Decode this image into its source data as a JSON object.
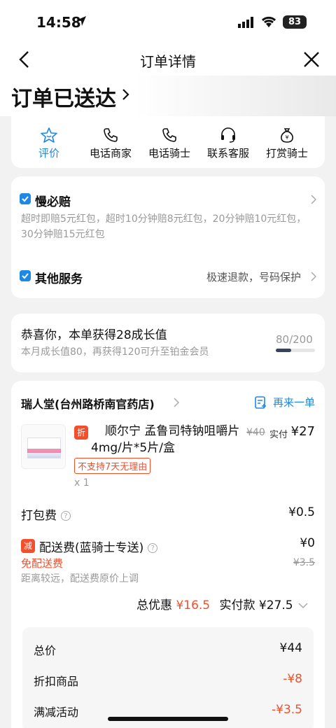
{
  "status": {
    "time": "14:58",
    "battery": "83"
  },
  "nav": {
    "title": "订单详情"
  },
  "hero": {
    "title": "订单已送达"
  },
  "actions": [
    {
      "label": "评价",
      "icon": "star-icon"
    },
    {
      "label": "电话商家",
      "icon": "phone-icon"
    },
    {
      "label": "电话骑士",
      "icon": "phone-icon"
    },
    {
      "label": "联系客服",
      "icon": "headset-icon"
    },
    {
      "label": "打赏骑士",
      "icon": "money-bag-icon"
    }
  ],
  "guarantee": {
    "slow": {
      "title": "慢必赔",
      "desc": "超时即赔5元红包，超时10分钟赔8元红包，20分钟赔10元红包，30分钟赔15元红包"
    },
    "other": {
      "title": "其他服务",
      "detail": "极速退款，号码保护"
    }
  },
  "growth": {
    "title": "恭喜你，本单获得28成长值",
    "desc": "本月成长值80，再获得120可升至铂金会员",
    "progress_text": "80/200",
    "progress": 0.4
  },
  "order": {
    "store": "瑞人堂(台州路桥南官药店)",
    "reorder": "再来一单",
    "product": {
      "discount_tag": "折",
      "name": "顺尔宁 孟鲁司特钠咀嚼片 4mg/片*5片/盒",
      "old_price": "¥40",
      "pay_label": "实付",
      "pay_price": "¥27",
      "no_return": "不支持7天无理由",
      "qty": "x 1"
    },
    "packing": {
      "label": "打包费",
      "value": "¥0.5"
    },
    "delivery": {
      "tag": "减",
      "label": "配送费(蓝骑士专送)",
      "value": "¥0",
      "free": "免配送费",
      "original": "¥3.5",
      "note": "距离较远，配送费原价上调"
    },
    "totals": {
      "discount_label": "总优惠",
      "discount": "¥16.5",
      "paid_label": "实付款",
      "paid": "¥27.5"
    },
    "breakdown": [
      {
        "label": "总价",
        "value": "¥44",
        "red": false
      },
      {
        "label": "折扣商品",
        "value": "-¥8",
        "red": true
      },
      {
        "label": "满减活动",
        "value": "-¥3.5",
        "red": true
      }
    ]
  },
  "colors": {
    "accent": "#1e88e5",
    "red": "#f24f2a"
  }
}
